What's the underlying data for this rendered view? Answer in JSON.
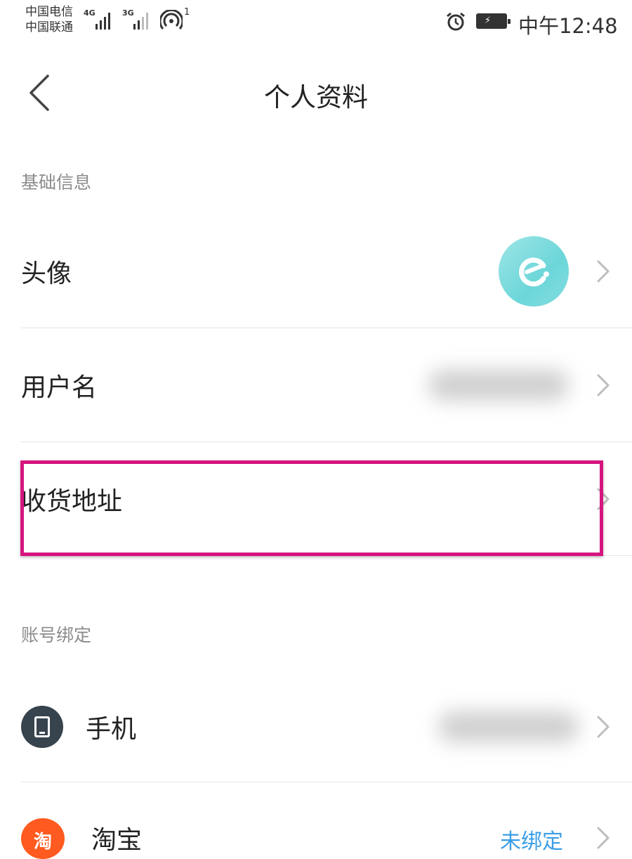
{
  "status_bar": {
    "carrier_1": "中国电信",
    "carrier_2": "中国联通",
    "network_1": "4G",
    "network_2": "3G",
    "hotspot_count": "1",
    "time": "中午12:48",
    "icons": [
      "signal-icon",
      "hotspot-icon",
      "alarm-icon",
      "battery-charging-icon"
    ]
  },
  "nav": {
    "title": "个人资料",
    "back_icon": "chevron-left-icon"
  },
  "sections": {
    "basic_info": "基础信息",
    "account_binding": "账号绑定"
  },
  "rows": {
    "avatar": "头像",
    "username": "用户名",
    "address": "收货地址",
    "phone": "手机",
    "taobao": "淘宝"
  },
  "taobao": {
    "icon_text": "淘",
    "status": "未绑定"
  },
  "colors": {
    "highlight": "#d6157f",
    "link_blue": "#3a9ee4",
    "taobao_orange": "#ff5a1f",
    "avatar_teal": "#7fdcde"
  }
}
